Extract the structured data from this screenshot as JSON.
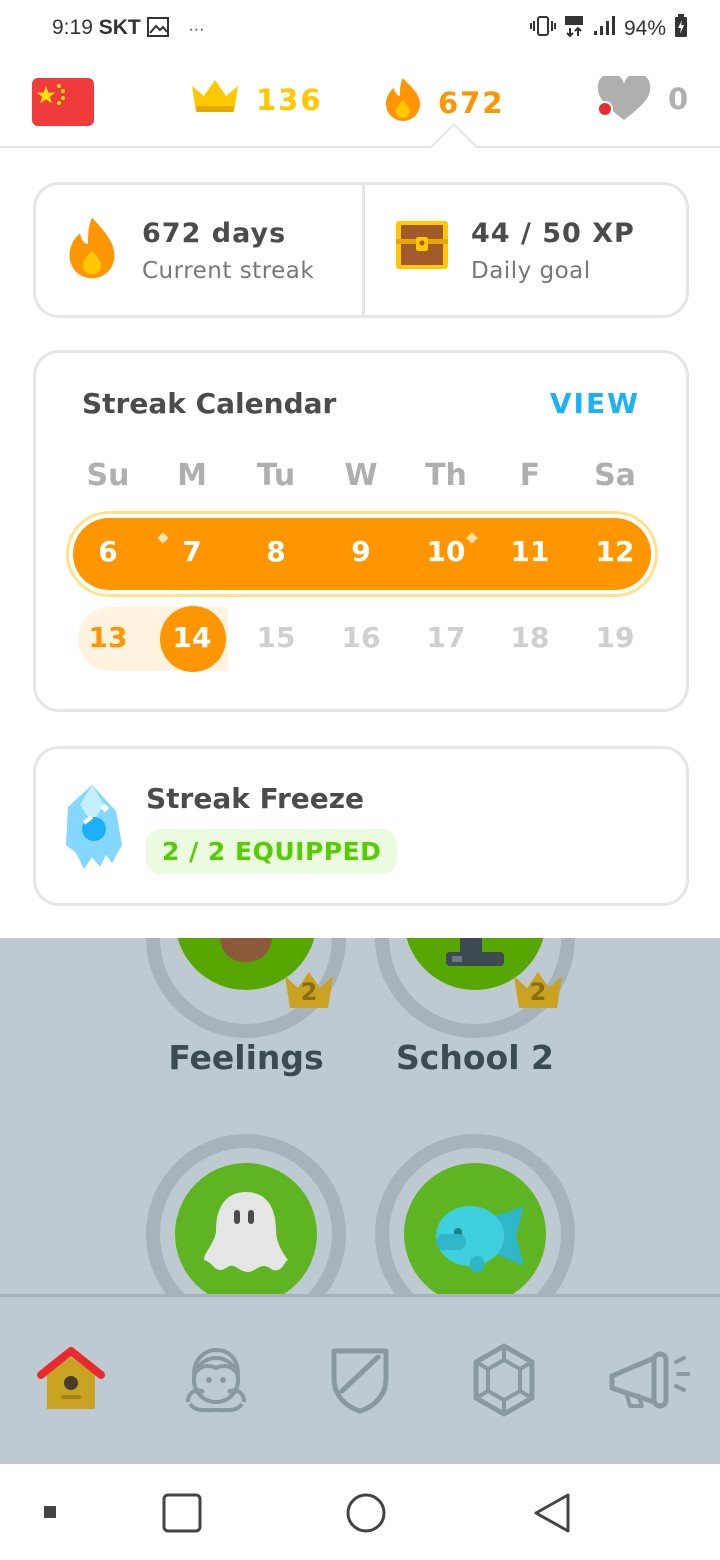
{
  "status_bar": {
    "time": "9:19",
    "carrier": "SKT",
    "more": "···",
    "battery": "94%"
  },
  "top_bar": {
    "crowns": "136",
    "streak": "672",
    "hearts": "0"
  },
  "stats": {
    "streak_value": "672 days",
    "streak_label": "Current streak",
    "xp_value": "44 / 50 XP",
    "xp_label": "Daily goal"
  },
  "calendar": {
    "title": "Streak Calendar",
    "view_label": "VIEW",
    "day_names": [
      "Su",
      "M",
      "Tu",
      "W",
      "Th",
      "F",
      "Sa"
    ],
    "week1": [
      "6",
      "7",
      "8",
      "9",
      "10",
      "11",
      "12"
    ],
    "week2": [
      "13",
      "14",
      "15",
      "16",
      "17",
      "18",
      "19"
    ]
  },
  "freeze": {
    "title": "Streak Freeze",
    "badge": "2 / 2 EQUIPPED"
  },
  "skills": {
    "feelings": {
      "label": "Feelings",
      "level": "2"
    },
    "school2": {
      "label": "School 2",
      "level": "2"
    }
  },
  "colors": {
    "orange": "#ff9600",
    "gold": "#ffc800",
    "blue": "#1cb0f6",
    "green": "#58cc02",
    "map_bg": "#bdcad1"
  }
}
